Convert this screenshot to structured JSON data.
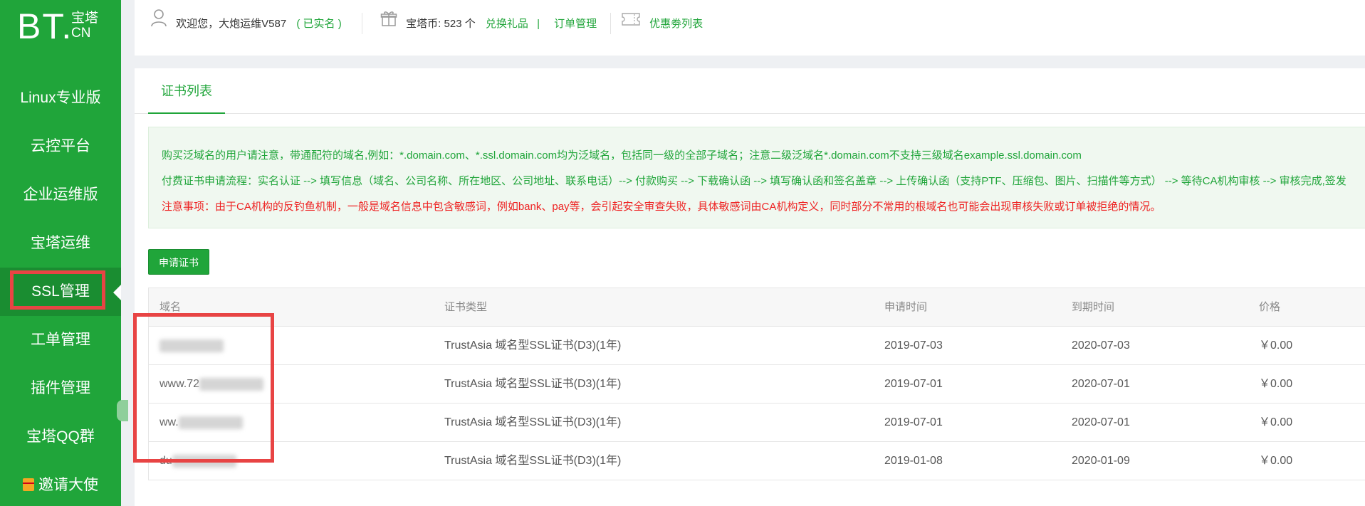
{
  "brand": {
    "logo_main": "BT.",
    "logo_top": "宝塔",
    "logo_bottom": "CN"
  },
  "sidebar": {
    "items": [
      {
        "label": "Linux专业版"
      },
      {
        "label": "云控平台"
      },
      {
        "label": "企业运维版"
      },
      {
        "label": "宝塔运维"
      },
      {
        "label": "SSL管理",
        "active": true
      },
      {
        "label": "工单管理"
      },
      {
        "label": "插件管理"
      },
      {
        "label": "宝塔QQ群"
      },
      {
        "label": "邀请大使"
      }
    ]
  },
  "header": {
    "welcome": "欢迎您，大炮运维V587",
    "verified": "( 已实名 )",
    "coins": "宝塔币: 523 个",
    "exchange": "兑换礼品",
    "sep": "|",
    "orders": "订单管理",
    "coupons": "优惠劵列表"
  },
  "main": {
    "tab": "证书列表",
    "notices": [
      "购买泛域名的用户请注意，带通配符的域名,例如：*.domain.com、*.ssl.domain.com均为泛域名，包括同一级的全部子域名；注意二级泛域名*.domain.com不支持三级域名example.ssl.domain.com",
      "付费证书申请流程：实名认证 --> 填写信息（域名、公司名称、所在地区、公司地址、联系电话）--> 付款购买 --> 下载确认函 --> 填写确认函和签名盖章 --> 上传确认函（支持PTF、压缩包、图片、扫描件等方式） --> 等待CA机构审核 --> 审核完成,签发",
      "注意事项：由于CA机构的反钓鱼机制，一般是域名信息中包含敏感词，例如bank、pay等，会引起安全审查失败，具体敏感词由CA机构定义，同时部分不常用的根域名也可能会出现审核失败或订单被拒绝的情况。"
    ],
    "apply_button": "申请证书",
    "table": {
      "headers": [
        "域名",
        "证书类型",
        "申请时间",
        "到期时间",
        "价格"
      ],
      "rows": [
        {
          "domain": "",
          "type": "TrustAsia 域名型SSL证书(D3)(1年)",
          "apply": "2019-07-03",
          "expire": "2020-07-03",
          "price": "￥0.00"
        },
        {
          "domain": "www.72",
          "type": "TrustAsia 域名型SSL证书(D3)(1年)",
          "apply": "2019-07-01",
          "expire": "2020-07-01",
          "price": "￥0.00"
        },
        {
          "domain": "ww.",
          "type": "TrustAsia 域名型SSL证书(D3)(1年)",
          "apply": "2019-07-01",
          "expire": "2020-07-01",
          "price": "￥0.00"
        },
        {
          "domain": "du",
          "type": "TrustAsia 域名型SSL证书(D3)(1年)",
          "apply": "2019-01-08",
          "expire": "2020-01-09",
          "price": "￥0.00"
        }
      ]
    }
  },
  "colors": {
    "brand_green": "#20a53a",
    "highlight_red": "#e84444",
    "notice_red": "#ee2222"
  }
}
